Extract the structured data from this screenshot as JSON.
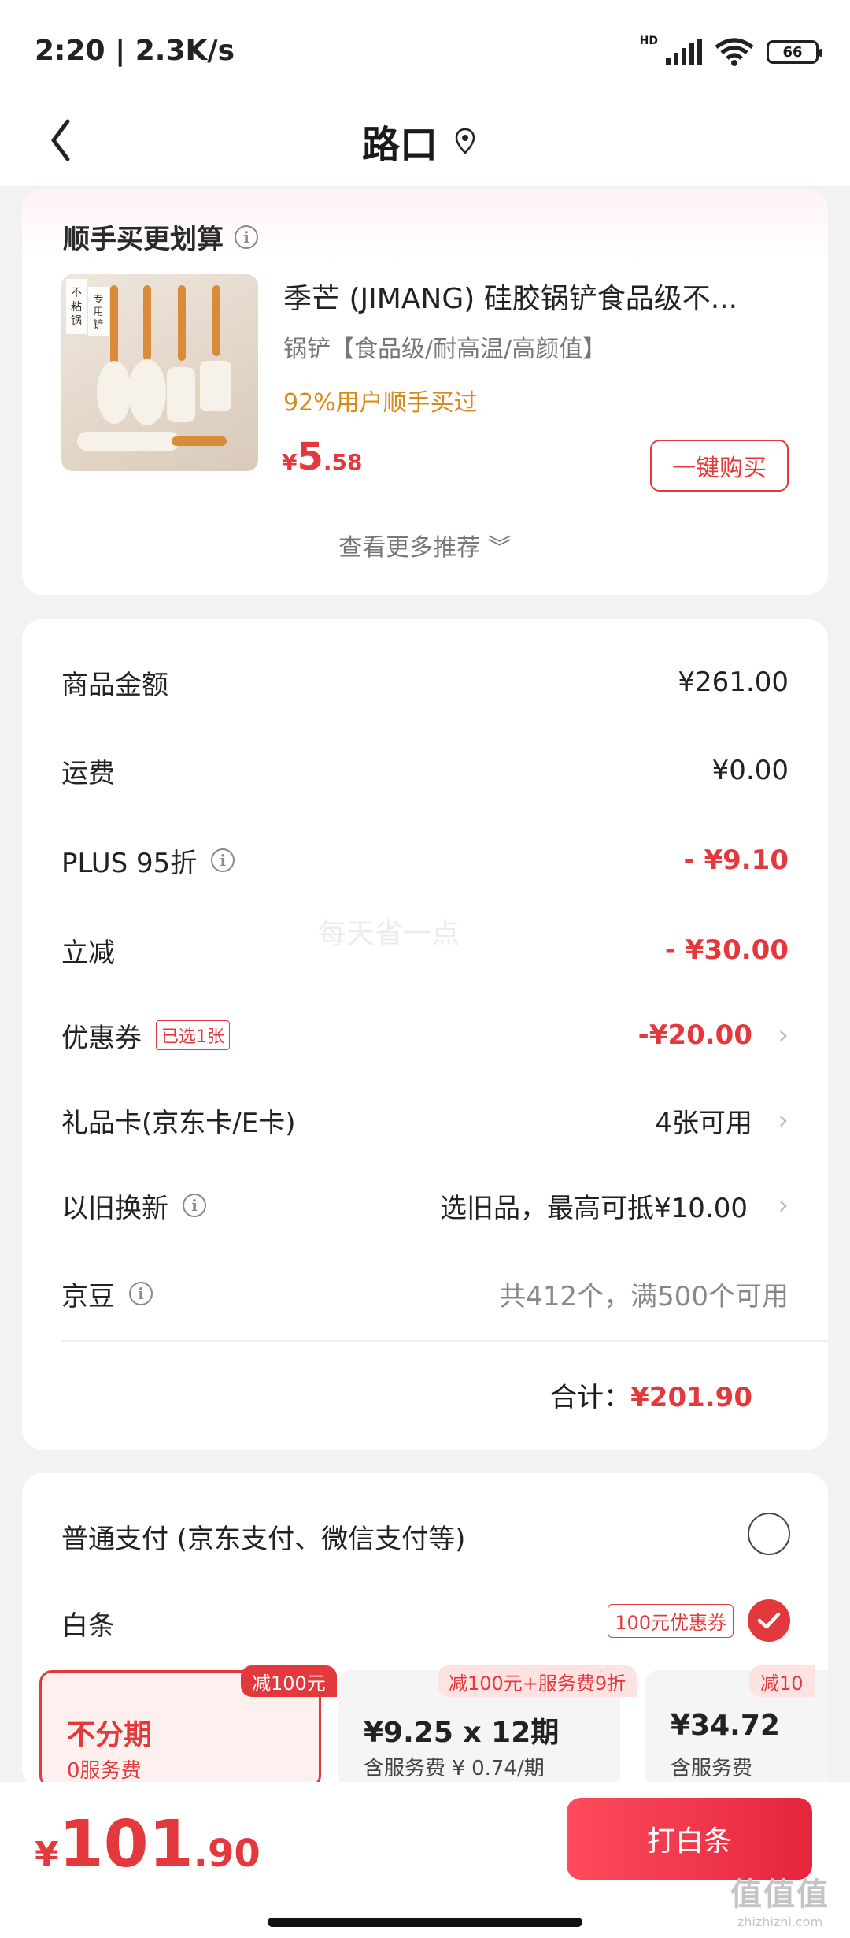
{
  "status_bar": {
    "time": "2:20 | 2.3K/s",
    "network": "HD",
    "wifi_label": "6",
    "battery": "66"
  },
  "nav": {
    "title": "路口"
  },
  "recommend": {
    "title": "顺手买更划算",
    "product": {
      "name": "季芒 (JIMANG) 硅胶锅铲食品级不...",
      "subtitle": "锅铲【食品级/耐高温/高颜值】",
      "tag": "92%用户顺手买过",
      "price_symbol": "¥",
      "price_int": "5",
      "price_dec": ".58",
      "buy_label": "一键购买",
      "image_text_1": "不粘锅",
      "image_text_2": "专用铲"
    },
    "more_label": "查看更多推荐 ︾"
  },
  "detail": {
    "watermark": "每天省一点",
    "rows": [
      {
        "label": "商品金额",
        "value": "¥261.00"
      },
      {
        "label": "运费",
        "value": "¥0.00"
      },
      {
        "label": "PLUS 95折",
        "value": "- ¥9.10"
      },
      {
        "label": "立减",
        "value": "- ¥30.00"
      },
      {
        "label": "优惠券",
        "badge": "已选1张",
        "value": "-¥20.00"
      },
      {
        "label": "礼品卡(京东卡/E卡)",
        "value": "4张可用"
      },
      {
        "label": "以旧换新",
        "value": "选旧品，最高可抵¥10.00"
      },
      {
        "label": "京豆",
        "value": "共412个，满500个可用"
      }
    ],
    "total_label": "合计：",
    "total_value": "¥201.90"
  },
  "payment": {
    "normal_label": "普通支付 (京东支付、微信支付等)",
    "baitiao_label": "白条",
    "baitiao_coupon": "100元优惠券",
    "plans": [
      {
        "tag": "减100元",
        "title": "不分期",
        "sub": "0服务费"
      },
      {
        "tag": "减100元+服务费9折",
        "title": "¥9.25 x 12期",
        "sub": "含服务费 ¥ 0.74/期"
      },
      {
        "tag": "减10",
        "title": "¥34.72",
        "sub": "含服务费"
      }
    ]
  },
  "bottom": {
    "price_symbol": "¥",
    "price_int": "101",
    "price_dec": ".90",
    "pay_label": "打白条",
    "site_logo": "值值值",
    "site_url": "zhizhizhi.com"
  },
  "colors": {
    "accent": "#e4393c",
    "tag_orange": "#d88a1a"
  }
}
